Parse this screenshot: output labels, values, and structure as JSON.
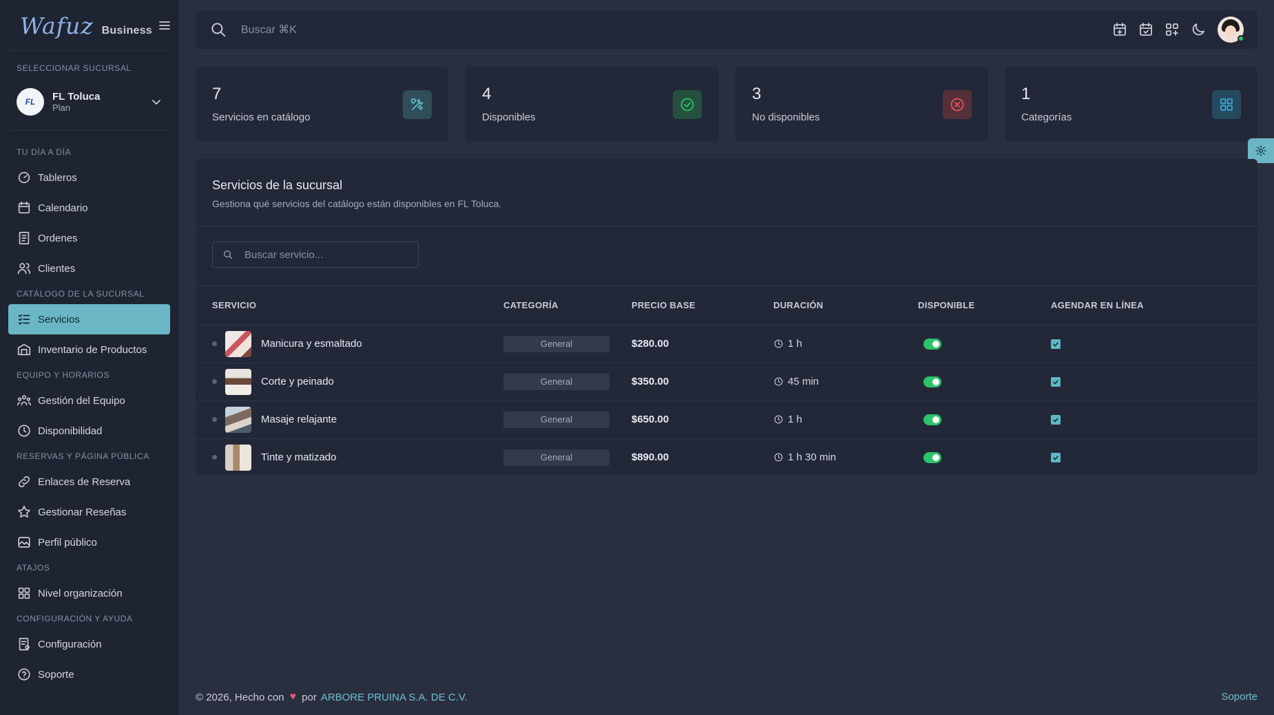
{
  "brand": {
    "logo": "Wafuz",
    "sub": "Business"
  },
  "sidebar": {
    "branch_section": "SELECCIONAR SUCURSAL",
    "branch": {
      "initials": "FL",
      "name": "FL Toluca",
      "plan": "Plan"
    },
    "sections": {
      "s1": "TU DÍA A DÍA",
      "s2": "CATÁLOGO DE LA SUCURSAL",
      "s3": "EQUIPO Y HORARIOS",
      "s4": "RESERVAS Y PÁGINA PÚBLICA",
      "s5": "ATAJOS",
      "s6": "CONFIGURACIÓN Y AYUDA"
    },
    "items": {
      "tableros": "Tableros",
      "calendario": "Calendario",
      "ordenes": "Ordenes",
      "clientes": "Clientes",
      "servicios": "Servicios",
      "inventario": "Inventario de Productos",
      "equipo": "Gestión del Equipo",
      "disponibilidad": "Disponibilidad",
      "enlaces": "Enlaces de Reserva",
      "resenas": "Gestionar Reseñas",
      "perfil": "Perfil público",
      "nivel": "Nivel organización",
      "configuracion": "Configuración",
      "soporte": "Soporte"
    }
  },
  "topbar": {
    "search_placeholder": "Buscar ⌘K"
  },
  "stats": [
    {
      "value": "7",
      "label": "Servicios en catálogo",
      "icon": "tools-icon",
      "color": "#5fb8c3"
    },
    {
      "value": "4",
      "label": "Disponibles",
      "icon": "check-circle-icon",
      "color": "#2bc46a"
    },
    {
      "value": "3",
      "label": "No disponibles",
      "icon": "x-circle-icon",
      "color": "#e45757"
    },
    {
      "value": "1",
      "label": "Categorías",
      "icon": "grid-icon",
      "color": "#3aa7d8"
    }
  ],
  "panel": {
    "title": "Servicios de la sucursal",
    "subtitle": "Gestiona qué servicios del catálogo están disponibles en FL Toluca.",
    "search_placeholder": "Buscar servicio...",
    "columns": [
      "SERVICIO",
      "CATEGORÍA",
      "PRECIO BASE",
      "DURACIÓN",
      "DISPONIBLE",
      "AGENDAR EN LÍNEA"
    ],
    "rows": [
      {
        "name": "Manicura y esmaltado",
        "category": "General",
        "price": "$280.00",
        "duration": "1 h",
        "available": true,
        "online": true
      },
      {
        "name": "Corte y peinado",
        "category": "General",
        "price": "$350.00",
        "duration": "45 min",
        "available": true,
        "online": true
      },
      {
        "name": "Masaje relajante",
        "category": "General",
        "price": "$650.00",
        "duration": "1 h",
        "available": true,
        "online": true
      },
      {
        "name": "Tinte y matizado",
        "category": "General",
        "price": "$890.00",
        "duration": "1 h 30 min",
        "available": true,
        "online": true
      }
    ]
  },
  "footer": {
    "copyright": "© 2026, Hecho con",
    "heart": "♥",
    "by": "por",
    "company": "ARBORE PRUINA S.A. DE C.V.",
    "support": "Soporte"
  }
}
